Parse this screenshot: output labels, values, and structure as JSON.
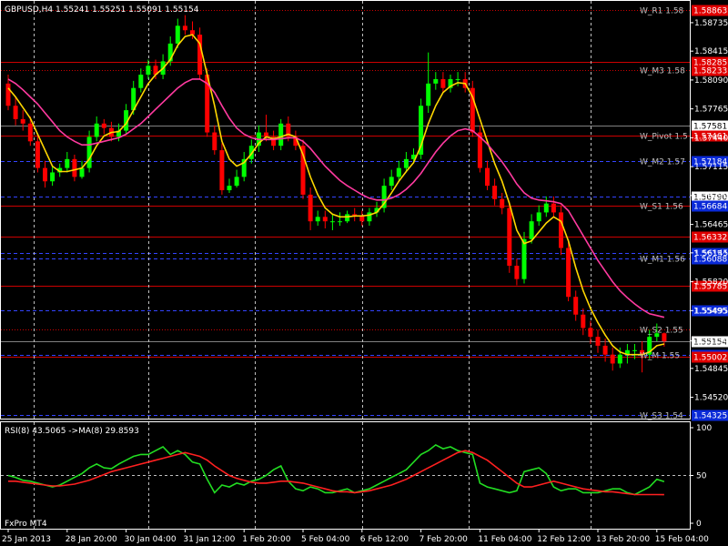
{
  "window": {
    "title": "GBPUSD,H4  1.55241 1.55251 1.55091 1.55154",
    "broker": "FxPro MT4"
  },
  "colors": {
    "background": "#000000",
    "bull": "#00ff00",
    "bear": "#ff0000",
    "ma_fast": "#ffd700",
    "ma_slow": "#ff3aa0",
    "rsi": "#22dd22",
    "rsi_ma": "#ff2020",
    "level_red": "#cc0000",
    "level_blue": "#3344ff",
    "tag_red": "#e00000",
    "tag_blue": "#0a2ad8"
  },
  "chart_data": [
    {
      "type": "candlestick",
      "title": "GBPUSD,H4  1.55241 1.55251 1.55091 1.55154",
      "ylim": [
        1.5428,
        1.5898
      ],
      "price_ticks": [
        "1.58735",
        "1.58415",
        "1.58090",
        "1.57765",
        "1.57440",
        "1.57115",
        "1.56790",
        "1.56465",
        "1.56145",
        "1.55820",
        "1.55495",
        "1.55154",
        "1.54845",
        "1.54520"
      ],
      "price_tick_values": [
        1.58735,
        1.58415,
        1.5809,
        1.57765,
        1.5744,
        1.57115,
        1.5679,
        1.56465,
        1.56145,
        1.5582,
        1.55495,
        1.55154,
        1.54845,
        1.5452
      ],
      "time_labels": [
        "25 Jan 2013",
        "28 Jan 20:00",
        "30 Jan 04:00",
        "31 Jan 12:00",
        "1 Feb 20:00",
        "5 Feb 04:00",
        "6 Feb 12:00",
        "7 Feb 20:00",
        "11 Feb 04:00",
        "12 Feb 12:00",
        "13 Feb 20:00",
        "15 Feb 04:00"
      ],
      "time_label_bars": [
        0,
        8,
        16,
        24,
        32,
        40,
        48,
        56,
        64,
        72,
        80,
        88
      ],
      "current_price": "1.55154",
      "bars": {
        "open": [
          1.5805,
          1.578,
          1.5765,
          1.576,
          1.574,
          1.571,
          1.5695,
          1.5705,
          1.571,
          1.572,
          1.57,
          1.571,
          1.5745,
          1.576,
          1.5755,
          1.5745,
          1.5752,
          1.5775,
          1.58,
          1.5815,
          1.5825,
          1.5815,
          1.583,
          1.585,
          1.587,
          1.5865,
          1.586,
          1.5815,
          1.575,
          1.573,
          1.5685,
          1.569,
          1.57,
          1.572,
          1.5735,
          1.575,
          1.5745,
          1.5735,
          1.576,
          1.5745,
          1.5735,
          1.568,
          1.565,
          1.5655,
          1.565,
          1.565,
          1.565,
          1.5658,
          1.5656,
          1.565,
          1.566,
          1.5665,
          1.569,
          1.57,
          1.571,
          1.572,
          1.5725,
          1.578,
          1.5805,
          1.581,
          1.58,
          1.581,
          1.581,
          1.58,
          1.575,
          1.571,
          1.569,
          1.5675,
          1.5665,
          1.56,
          1.5585,
          1.563,
          1.565,
          1.566,
          1.567,
          1.566,
          1.562,
          1.5565,
          1.5545,
          1.553,
          1.552,
          1.551,
          1.55,
          1.549,
          1.55,
          1.5505,
          1.5505,
          1.55,
          1.552,
          1.5524
        ],
        "close": [
          1.578,
          1.5765,
          1.576,
          1.574,
          1.571,
          1.5695,
          1.5705,
          1.571,
          1.572,
          1.57,
          1.571,
          1.5745,
          1.576,
          1.5755,
          1.5745,
          1.5752,
          1.5775,
          1.58,
          1.5815,
          1.5825,
          1.5815,
          1.583,
          1.585,
          1.587,
          1.5865,
          1.586,
          1.5815,
          1.575,
          1.573,
          1.5685,
          1.569,
          1.57,
          1.572,
          1.5735,
          1.575,
          1.5745,
          1.5735,
          1.576,
          1.5745,
          1.5735,
          1.568,
          1.565,
          1.5655,
          1.565,
          1.565,
          1.565,
          1.5658,
          1.5656,
          1.565,
          1.566,
          1.5665,
          1.569,
          1.57,
          1.571,
          1.572,
          1.5725,
          1.578,
          1.5805,
          1.581,
          1.58,
          1.581,
          1.581,
          1.58,
          1.575,
          1.571,
          1.569,
          1.5675,
          1.5665,
          1.56,
          1.5585,
          1.563,
          1.565,
          1.566,
          1.567,
          1.566,
          1.562,
          1.5565,
          1.5545,
          1.553,
          1.552,
          1.551,
          1.55,
          1.549,
          1.55,
          1.5505,
          1.5505,
          1.55,
          1.552,
          1.5524,
          1.5515
        ],
        "high": [
          1.5815,
          1.579,
          1.5775,
          1.5768,
          1.5748,
          1.5718,
          1.5712,
          1.5715,
          1.5728,
          1.5725,
          1.5718,
          1.5752,
          1.5768,
          1.5765,
          1.5762,
          1.576,
          1.5782,
          1.5808,
          1.5822,
          1.5832,
          1.5832,
          1.5838,
          1.5858,
          1.5878,
          1.5882,
          1.5875,
          1.5868,
          1.5822,
          1.5758,
          1.5738,
          1.5698,
          1.5708,
          1.5728,
          1.5742,
          1.5758,
          1.577,
          1.5752,
          1.5765,
          1.5768,
          1.5752,
          1.5742,
          1.5688,
          1.5662,
          1.5662,
          1.5658,
          1.566,
          1.5662,
          1.5665,
          1.5662,
          1.5665,
          1.5672,
          1.5698,
          1.5708,
          1.5718,
          1.5728,
          1.5732,
          1.5788,
          1.584,
          1.5818,
          1.5818,
          1.5815,
          1.5818,
          1.5818,
          1.5808,
          1.5758,
          1.5718,
          1.5698,
          1.5682,
          1.5672,
          1.5608,
          1.5638,
          1.5658,
          1.5668,
          1.5678,
          1.5678,
          1.5668,
          1.5628,
          1.5572,
          1.5552,
          1.5538,
          1.5528,
          1.5518,
          1.5508,
          1.5508,
          1.5512,
          1.5512,
          1.5515,
          1.5528,
          1.5535,
          1.5525
        ],
        "low": [
          1.5775,
          1.5758,
          1.5752,
          1.5735,
          1.5705,
          1.5688,
          1.569,
          1.57,
          1.5705,
          1.5695,
          1.5698,
          1.5705,
          1.574,
          1.5748,
          1.574,
          1.574,
          1.5748,
          1.577,
          1.5795,
          1.581,
          1.581,
          1.581,
          1.5825,
          1.5845,
          1.586,
          1.5855,
          1.581,
          1.5745,
          1.5725,
          1.568,
          1.5682,
          1.5688,
          1.5695,
          1.5715,
          1.5728,
          1.574,
          1.573,
          1.573,
          1.574,
          1.573,
          1.5675,
          1.564,
          1.5645,
          1.5642,
          1.564,
          1.5645,
          1.5648,
          1.565,
          1.5645,
          1.5645,
          1.5655,
          1.566,
          1.5685,
          1.5695,
          1.5705,
          1.5715,
          1.572,
          1.5772,
          1.5798,
          1.5795,
          1.5795,
          1.5802,
          1.5795,
          1.5745,
          1.5705,
          1.5685,
          1.5668,
          1.5658,
          1.5592,
          1.5578,
          1.558,
          1.5625,
          1.5645,
          1.5655,
          1.5655,
          1.5612,
          1.556,
          1.5538,
          1.5522,
          1.5512,
          1.5502,
          1.5492,
          1.5482,
          1.5485,
          1.549,
          1.5495,
          1.548,
          1.5495,
          1.5515,
          1.5509
        ]
      },
      "moving_averages": [
        {
          "name": "fast",
          "color": "#ffd700",
          "values": [
            1.58,
            1.579,
            1.5778,
            1.5766,
            1.5748,
            1.573,
            1.5712,
            1.5706,
            1.5706,
            1.5708,
            1.571,
            1.572,
            1.5735,
            1.5746,
            1.575,
            1.5751,
            1.576,
            1.5775,
            1.579,
            1.5805,
            1.5815,
            1.5822,
            1.5832,
            1.5848,
            1.5858,
            1.586,
            1.585,
            1.5815,
            1.578,
            1.574,
            1.572,
            1.5712,
            1.5716,
            1.5726,
            1.5738,
            1.5745,
            1.5743,
            1.5745,
            1.5748,
            1.5745,
            1.5725,
            1.57,
            1.568,
            1.5665,
            1.5658,
            1.5655,
            1.5655,
            1.5656,
            1.5656,
            1.5657,
            1.566,
            1.567,
            1.5682,
            1.5695,
            1.5706,
            1.5716,
            1.5735,
            1.576,
            1.578,
            1.5795,
            1.5802,
            1.5806,
            1.5805,
            1.579,
            1.5765,
            1.574,
            1.5715,
            1.5695,
            1.567,
            1.564,
            1.5625,
            1.5628,
            1.5638,
            1.5648,
            1.5655,
            1.565,
            1.5628,
            1.5598,
            1.5572,
            1.5552,
            1.5536,
            1.5522,
            1.551,
            1.5503,
            1.55,
            1.55,
            1.55,
            1.5503,
            1.551,
            1.5512
          ]
        },
        {
          "name": "slow",
          "color": "#ff3aa0",
          "values": [
            1.581,
            1.5805,
            1.5798,
            1.579,
            1.5782,
            1.5772,
            1.5762,
            1.5752,
            1.5745,
            1.574,
            1.5736,
            1.5736,
            1.5738,
            1.574,
            1.5742,
            1.5744,
            1.5748,
            1.5754,
            1.576,
            1.5768,
            1.5776,
            1.5784,
            1.5792,
            1.58,
            1.5806,
            1.581,
            1.581,
            1.5805,
            1.5795,
            1.578,
            1.5766,
            1.5755,
            1.5748,
            1.5744,
            1.5742,
            1.5742,
            1.5742,
            1.5743,
            1.5744,
            1.5744,
            1.574,
            1.5732,
            1.5722,
            1.5712,
            1.5704,
            1.5696,
            1.569,
            1.5685,
            1.568,
            1.5676,
            1.5674,
            1.5674,
            1.5676,
            1.568,
            1.5686,
            1.5694,
            1.5704,
            1.5716,
            1.5728,
            1.5738,
            1.5746,
            1.5752,
            1.5754,
            1.5752,
            1.5745,
            1.5737,
            1.5727,
            1.5717,
            1.5705,
            1.5692,
            1.5682,
            1.5676,
            1.5674,
            1.5673,
            1.5672,
            1.567,
            1.5662,
            1.5648,
            1.5634,
            1.562,
            1.5606,
            1.5594,
            1.5582,
            1.5572,
            1.5564,
            1.5557,
            1.5551,
            1.5546,
            1.5544,
            1.5542
          ]
        }
      ],
      "levels": [
        {
          "label": "W_R1 1.58",
          "price": 1.5888,
          "style": "red-dotted",
          "tag": "1.58863",
          "tag_color": "red"
        },
        {
          "label": "",
          "price": 1.5829,
          "style": "red-solid",
          "tag": "1.58285",
          "tag_color": "red"
        },
        {
          "label": "W_M3 1.58",
          "price": 1.582,
          "style": "red-dotted",
          "tag": "1.58233",
          "tag_color": "red"
        },
        {
          "label": "",
          "price": 1.5758,
          "style": "gray-solid",
          "tag": "1.57581",
          "tag_color": "white"
        },
        {
          "label": "W_Pivot 1.5",
          "price": 1.5746,
          "style": "red-solid",
          "tag": "1.57461",
          "tag_color": "red"
        },
        {
          "label": "W_M2 1.57",
          "price": 1.5718,
          "style": "blue-dashed",
          "tag": "1.57184",
          "tag_color": "blue"
        },
        {
          "label": "",
          "price": 1.5678,
          "style": "blue-dashed",
          "tag": "1.56790",
          "tag_color": "white"
        },
        {
          "label": "W_S1 1.56",
          "price": 1.5668,
          "style": "red-solid",
          "tag": "1.56684",
          "tag_color": "blue"
        },
        {
          "label": "",
          "price": 1.5633,
          "style": "red-solid",
          "tag": "1.56332",
          "tag_color": "red"
        },
        {
          "label": "",
          "price": 1.5614,
          "style": "blue-dashed",
          "tag": "1.56154",
          "tag_color": "blue"
        },
        {
          "label": "W_M1 1.56",
          "price": 1.5608,
          "style": "blue-dashed",
          "tag": "1.56088",
          "tag_color": "blue"
        },
        {
          "label": "",
          "price": 1.5578,
          "style": "red-solid",
          "tag": "1.55785",
          "tag_color": "red"
        },
        {
          "label": "",
          "price": 1.555,
          "style": "blue-dashed",
          "tag": "1.55495",
          "tag_color": "blue"
        },
        {
          "label": "W_S2 1.55",
          "price": 1.5528,
          "style": "red-dotted",
          "tag": "",
          "tag_color": "red"
        },
        {
          "label": "",
          "price": 1.5515,
          "style": "gray-solid",
          "tag": "1.55154",
          "tag_color": "white"
        },
        {
          "label": "W_M 1.55",
          "price": 1.55,
          "style": "blue-dashed",
          "tag": "1.55088",
          "tag_color": "blue"
        },
        {
          "label": "",
          "price": 1.5498,
          "style": "red-solid",
          "tag": "1.55002",
          "tag_color": "red"
        },
        {
          "label": "W_S3 1.54",
          "price": 1.5432,
          "style": "blue-dashed",
          "tag": "1.54325",
          "tag_color": "blue"
        }
      ],
      "vertical_dividers_at_bars": [
        3.5,
        19,
        33.5,
        48,
        62.5,
        79
      ]
    },
    {
      "type": "line",
      "title": "RSI(8) 43.5065  ->MA(8) 29.8593",
      "ylim": [
        0,
        100
      ],
      "ticks": [
        "100",
        "50",
        "0"
      ],
      "tick_values": [
        100,
        50,
        0
      ],
      "series": [
        {
          "name": "RSI(8)",
          "color": "#22dd22",
          "values": [
            50,
            48,
            45,
            44,
            42,
            40,
            38,
            40,
            44,
            48,
            52,
            58,
            62,
            58,
            57,
            62,
            66,
            70,
            72,
            72,
            76,
            80,
            72,
            76,
            72,
            64,
            62,
            46,
            32,
            40,
            38,
            42,
            40,
            44,
            46,
            50,
            56,
            60,
            44,
            36,
            34,
            38,
            36,
            32,
            32,
            34,
            36,
            32,
            34,
            36,
            40,
            44,
            48,
            52,
            56,
            64,
            72,
            76,
            82,
            78,
            80,
            76,
            74,
            72,
            42,
            38,
            36,
            34,
            32,
            34,
            54,
            56,
            58,
            52,
            38,
            34,
            36,
            36,
            32,
            32,
            32,
            34,
            36,
            36,
            32,
            30,
            34,
            38,
            46,
            43.5
          ]
        },
        {
          "name": "MA(8)",
          "color": "#ff2020",
          "values": [
            44,
            44,
            43,
            42,
            41,
            40,
            39,
            39,
            40,
            41,
            43,
            45,
            48,
            51,
            54,
            56,
            58,
            60,
            62,
            64,
            66,
            68,
            70,
            72,
            74,
            72,
            70,
            66,
            60,
            55,
            50,
            47,
            45,
            43,
            42,
            42,
            43,
            44,
            44,
            43,
            42,
            40,
            38,
            36,
            34,
            33,
            33,
            32,
            33,
            34,
            36,
            38,
            40,
            43,
            46,
            50,
            54,
            58,
            62,
            66,
            70,
            74,
            76,
            74,
            70,
            66,
            60,
            54,
            48,
            42,
            38,
            38,
            40,
            42,
            44,
            42,
            40,
            38,
            36,
            35,
            34,
            33,
            33,
            32,
            31,
            30,
            30,
            30,
            30,
            29.86
          ]
        }
      ],
      "reference_lines": [
        50
      ]
    }
  ]
}
